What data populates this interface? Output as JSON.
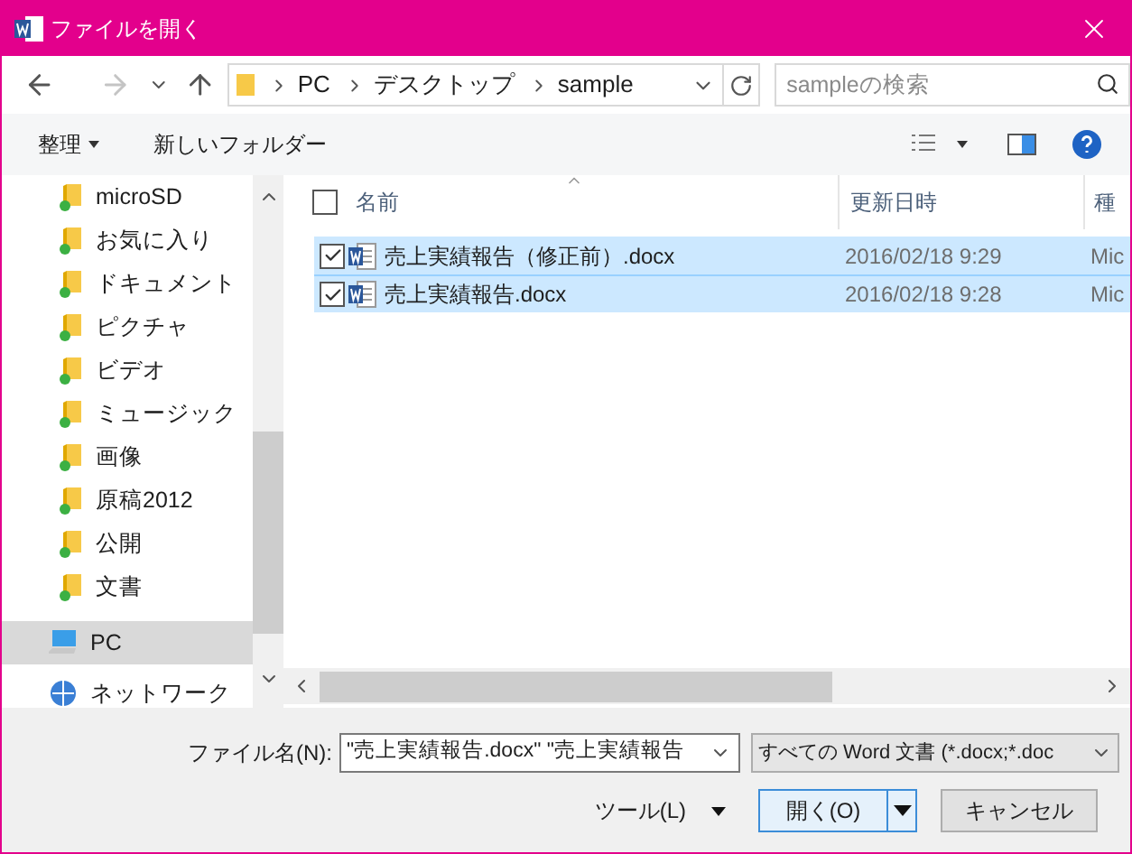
{
  "window": {
    "title": "ファイルを開く"
  },
  "address": {
    "path": [
      "PC",
      "デスクトップ",
      "sample"
    ]
  },
  "search": {
    "placeholder": "sampleの検索"
  },
  "toolbar": {
    "organize": "整理",
    "new_folder": "新しいフォルダー"
  },
  "sidebar": {
    "items": [
      {
        "label": "microSD",
        "kind": "folder",
        "selected": false
      },
      {
        "label": "お気に入り",
        "kind": "folder",
        "selected": false
      },
      {
        "label": "ドキュメント",
        "kind": "folder",
        "selected": false
      },
      {
        "label": "ピクチャ",
        "kind": "folder",
        "selected": false
      },
      {
        "label": "ビデオ",
        "kind": "folder",
        "selected": false
      },
      {
        "label": "ミュージック",
        "kind": "folder",
        "selected": false
      },
      {
        "label": "画像",
        "kind": "folder",
        "selected": false
      },
      {
        "label": "原稿2012",
        "kind": "folder",
        "selected": false
      },
      {
        "label": "公開",
        "kind": "folder",
        "selected": false
      },
      {
        "label": "文書",
        "kind": "folder",
        "selected": false
      },
      {
        "label": "PC",
        "kind": "pc",
        "selected": true
      },
      {
        "label": "ネットワーク",
        "kind": "network",
        "selected": false
      }
    ]
  },
  "table": {
    "select_all": {
      "checked": false
    },
    "columns": [
      {
        "label": "名前"
      },
      {
        "label": "更新日時"
      },
      {
        "label": "種"
      }
    ],
    "rows": [
      {
        "name": "売上実績報告（修正前）.docx",
        "modified": "2016/02/18 9:29",
        "type": "Mic",
        "selected": true,
        "checked": true
      },
      {
        "name": "売上実績報告.docx",
        "modified": "2016/02/18 9:28",
        "type": "Mic",
        "selected": true,
        "checked": true
      }
    ]
  },
  "footer": {
    "filename_label": "ファイル名(N):",
    "filename_value": "\"売上実績報告.docx\" \"売上実績報告",
    "filter": "すべての Word 文書 (*.docx;*.doc",
    "tools": "ツール(L)",
    "open": "開く(O)",
    "cancel": "キャンセル"
  }
}
